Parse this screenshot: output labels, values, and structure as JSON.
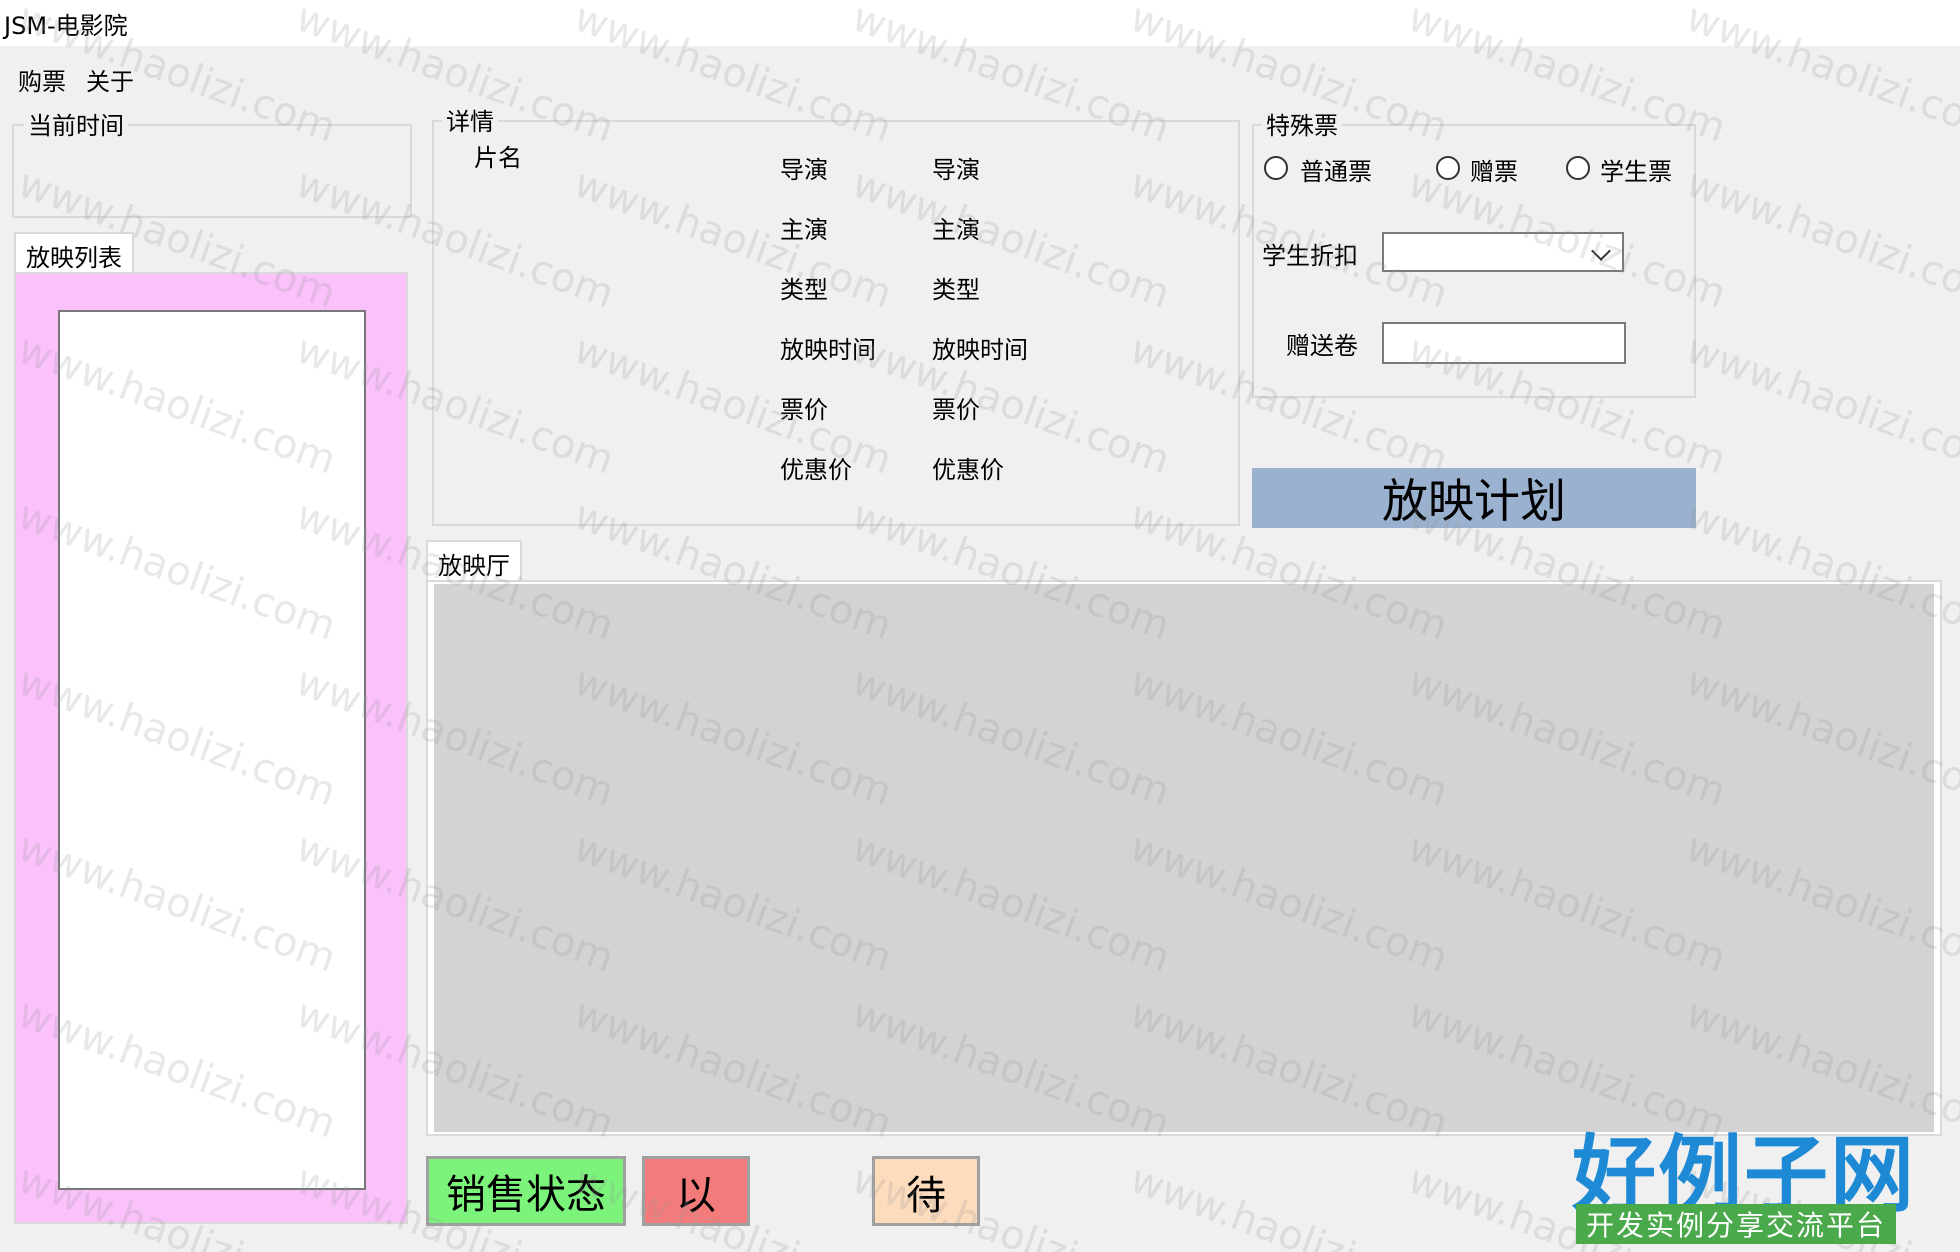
{
  "window": {
    "title": "JSM-电影院"
  },
  "menu": {
    "items": [
      "购票",
      "关于"
    ]
  },
  "current_time": {
    "label": "当前时间"
  },
  "screening_list": {
    "tab_label": "放映列表"
  },
  "details": {
    "group_label": "详情",
    "title_label": "片名",
    "rows": [
      {
        "label": "导演",
        "value": "导演"
      },
      {
        "label": "主演",
        "value": "主演"
      },
      {
        "label": "类型",
        "value": "类型"
      },
      {
        "label": "放映时间",
        "value": "放映时间"
      },
      {
        "label": "票价",
        "value": "票价"
      },
      {
        "label": "优惠价",
        "value": "优惠价"
      }
    ]
  },
  "special_ticket": {
    "group_label": "特殊票",
    "options": [
      "普通票",
      "赠票",
      "学生票"
    ],
    "student_discount_label": "学生折扣",
    "student_discount_value": "",
    "gift_voucher_label": "赠送卷",
    "gift_voucher_value": ""
  },
  "schedule_button": {
    "label": "放映计划",
    "color": "#9ab2cf"
  },
  "hall": {
    "tab_label": "放映厅"
  },
  "legend": {
    "sale_status": {
      "label": "销售状态",
      "color": "#7cf47c"
    },
    "sold": {
      "label": "以",
      "color": "#f47b7b"
    },
    "pending": {
      "label": "待",
      "color": "#fddcbd"
    }
  },
  "watermark": {
    "text": "www.haolizi.com"
  },
  "logo": {
    "title": "好例子网",
    "subtitle": "开发实例分享交流平台"
  },
  "colors": {
    "list_panel_bg": "#fbc1fb",
    "hall_bg": "#d3d3d3",
    "window_bg": "#f0f0f0"
  }
}
